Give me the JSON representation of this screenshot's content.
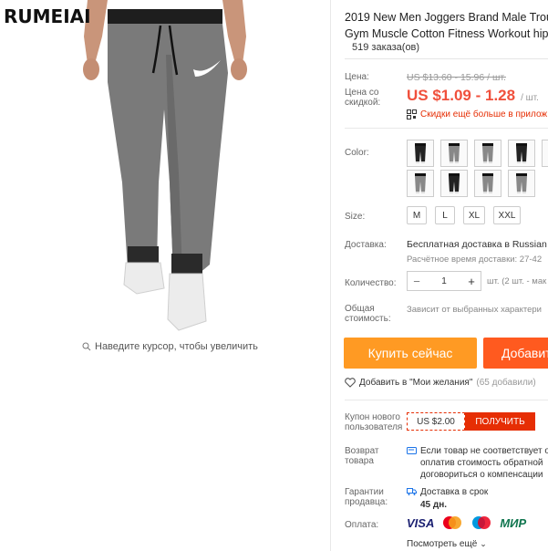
{
  "brand": "RUMEIAI",
  "zoom_hint": "Наведите курсор, чтобы увеличить",
  "product": {
    "title_line1": "2019 New Men Joggers Brand Male Trous",
    "title_line2": "Gym Muscle Cotton Fitness Workout hip l",
    "orders": "519 заказа(ов)"
  },
  "price": {
    "label": "Цена:",
    "old": "US $13.60 - 15.96 / шт.",
    "discount_label_1": "Цена со",
    "discount_label_2": "скидкой:",
    "new": "US $1.09 - 1.28",
    "new_unit": "/ шт.",
    "promo": "Скидки ещё больше в прилож"
  },
  "color": {
    "label": "Color:",
    "swatches": [
      "black",
      "gray",
      "gray",
      "black",
      "gray",
      "gray",
      "black",
      "gray",
      "gray"
    ]
  },
  "size": {
    "label": "Size:",
    "options": [
      "M",
      "L",
      "XL",
      "XXL"
    ]
  },
  "delivery": {
    "label": "Доставка:",
    "value": "Бесплатная доставка в Russian",
    "eta": "Расчётное время доставки: 27-42"
  },
  "quantity": {
    "label": "Количество:",
    "minus": "−",
    "value": "1",
    "plus": "+",
    "available": "шт. (2 шт. - мак"
  },
  "total": {
    "label_1": "Общая",
    "label_2": "стоимость:",
    "value": "Зависит от выбранных характери"
  },
  "actions": {
    "buy": "Купить сейчас",
    "cart": "Добавит",
    "wishlist": "Добавить в \"Мои желания\"",
    "wishlist_count": "(65 добавили)"
  },
  "coupon": {
    "label_1": "Купон нового",
    "label_2": "пользователя",
    "amount": "US $2.00",
    "get": "ПОЛУЧИТЬ"
  },
  "returns": {
    "label_1": "Возврат",
    "label_2": "товара",
    "line1": "Если товар не соответствует о",
    "line2": "оплатив стоимость обратной",
    "line3": "договориться о компенсации"
  },
  "guarantee": {
    "label_1": "Гарантии",
    "label_2": "продавца:",
    "line1": "Доставка в срок",
    "line2": "45 дн."
  },
  "payment": {
    "label": "Оплата:",
    "visa": "VISA",
    "mir": "МИР",
    "more": "Посмотреть ещё"
  },
  "colors": {
    "accent_red": "#f0503c",
    "buy_orange": "#ff9a23",
    "cart_orange": "#ff5a1f",
    "coupon_red": "#e62e04"
  }
}
